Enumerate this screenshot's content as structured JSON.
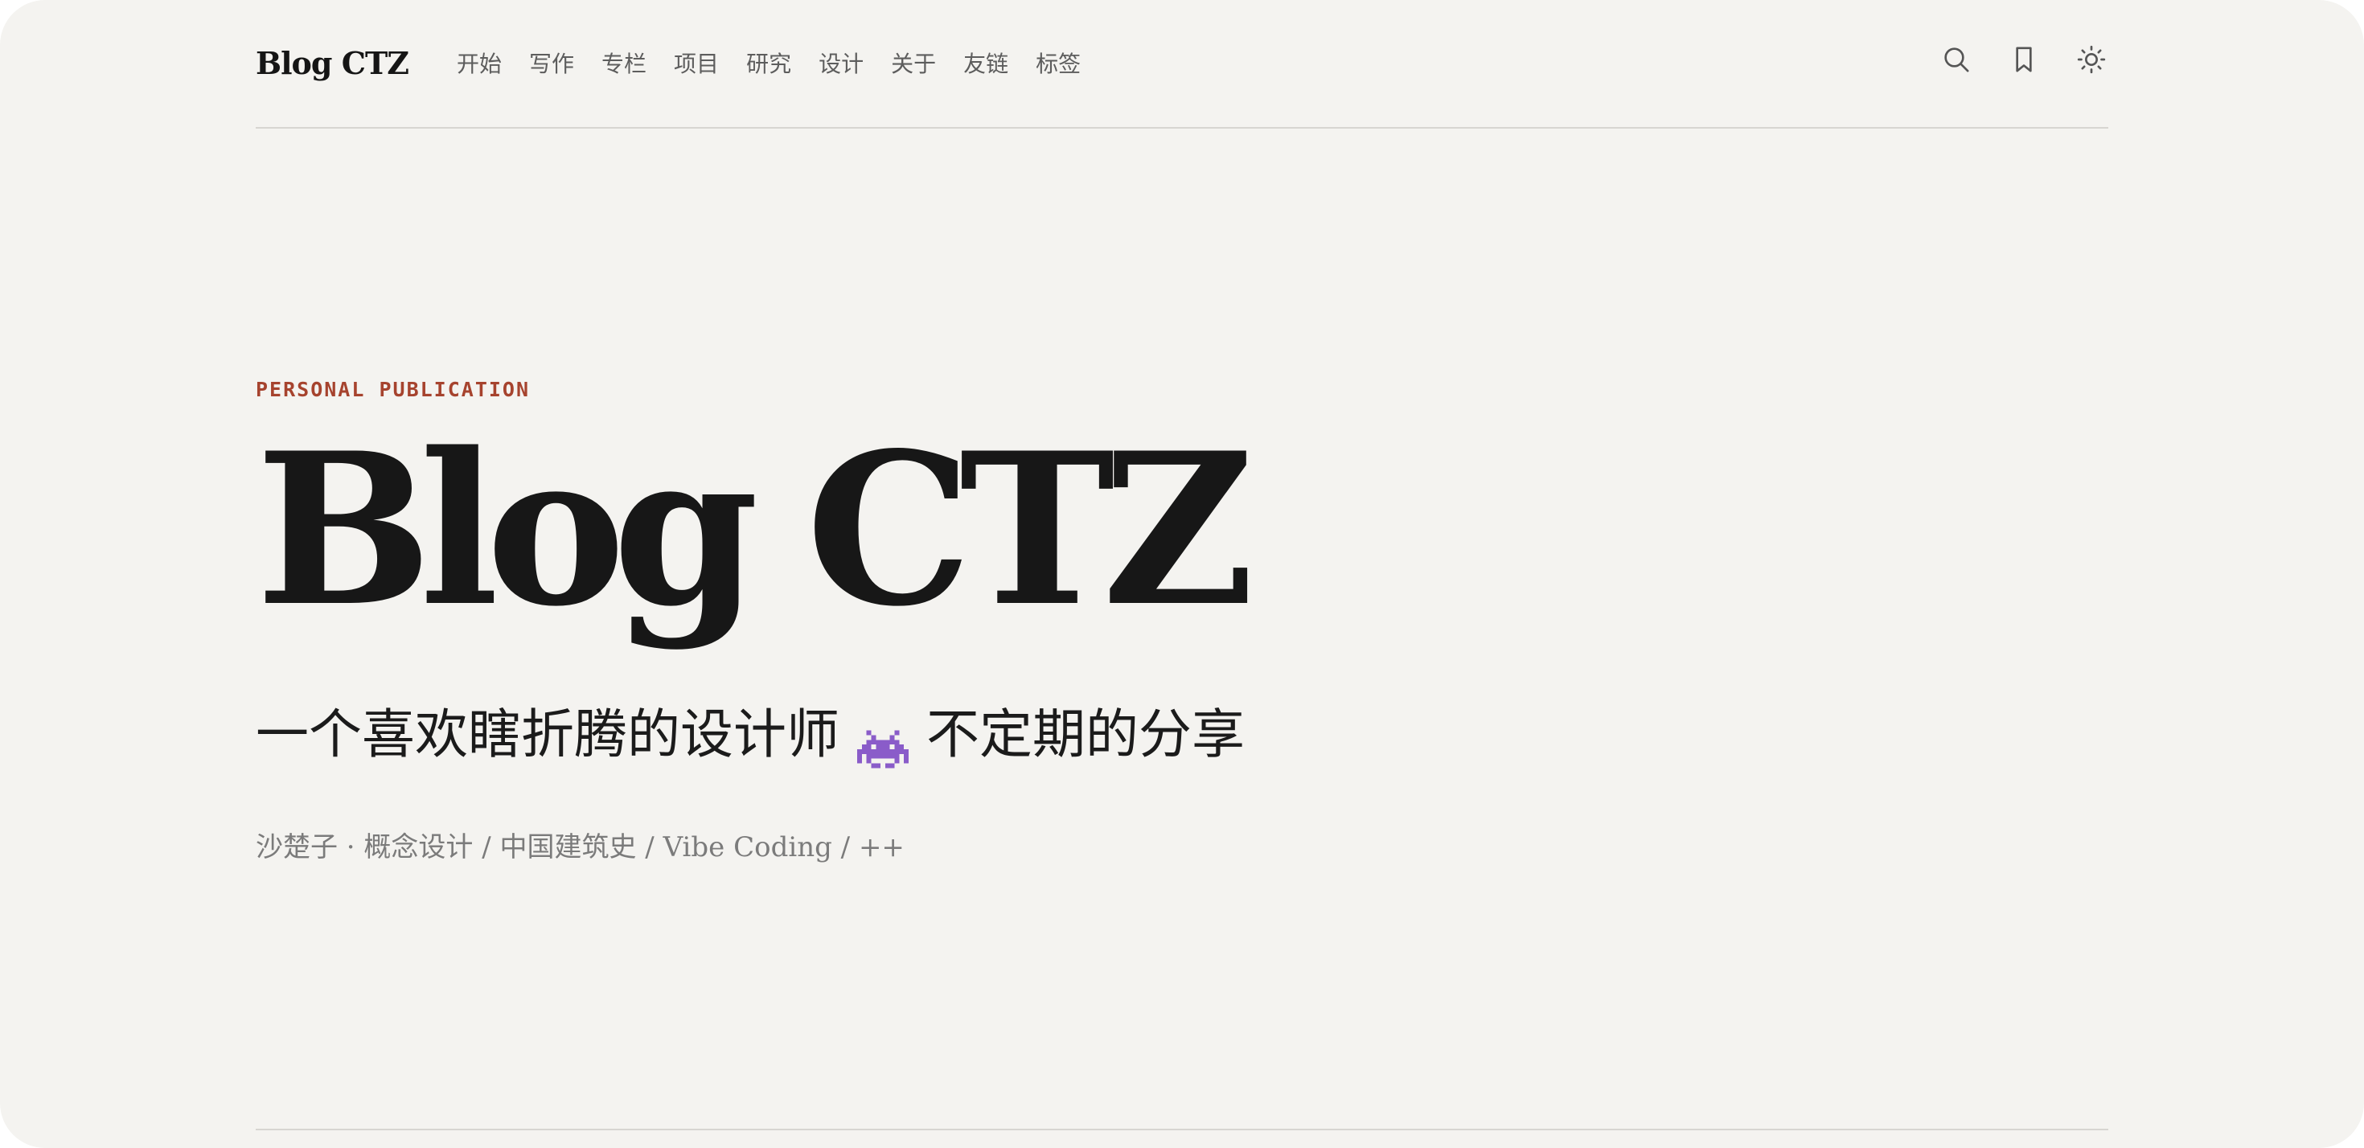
{
  "header": {
    "site_name": "Blog CTZ",
    "nav": [
      {
        "label": "开始"
      },
      {
        "label": "写作"
      },
      {
        "label": "专栏"
      },
      {
        "label": "项目"
      },
      {
        "label": "研究"
      },
      {
        "label": "设计"
      },
      {
        "label": "关于"
      },
      {
        "label": "友链"
      },
      {
        "label": "标签"
      }
    ],
    "icons": [
      "search-icon",
      "bookmark-icon",
      "sun-icon"
    ]
  },
  "hero": {
    "eyebrow": "PERSONAL PUBLICATION",
    "title": "Blog CTZ",
    "tagline_before": "一个喜欢瞎折腾的设计师",
    "tagline_icon": "space-invader-icon",
    "tagline_after": "不定期的分享",
    "meta": "沙楚子 · 概念设计 / 中国建筑史 / Vibe Coding / ++"
  },
  "colors": {
    "background": "#f4f3f0",
    "accent": "#a6432e",
    "text": "#171717",
    "muted": "#7b7b7b",
    "divider": "#d7d5d1",
    "invader": "#8a5cc9"
  }
}
